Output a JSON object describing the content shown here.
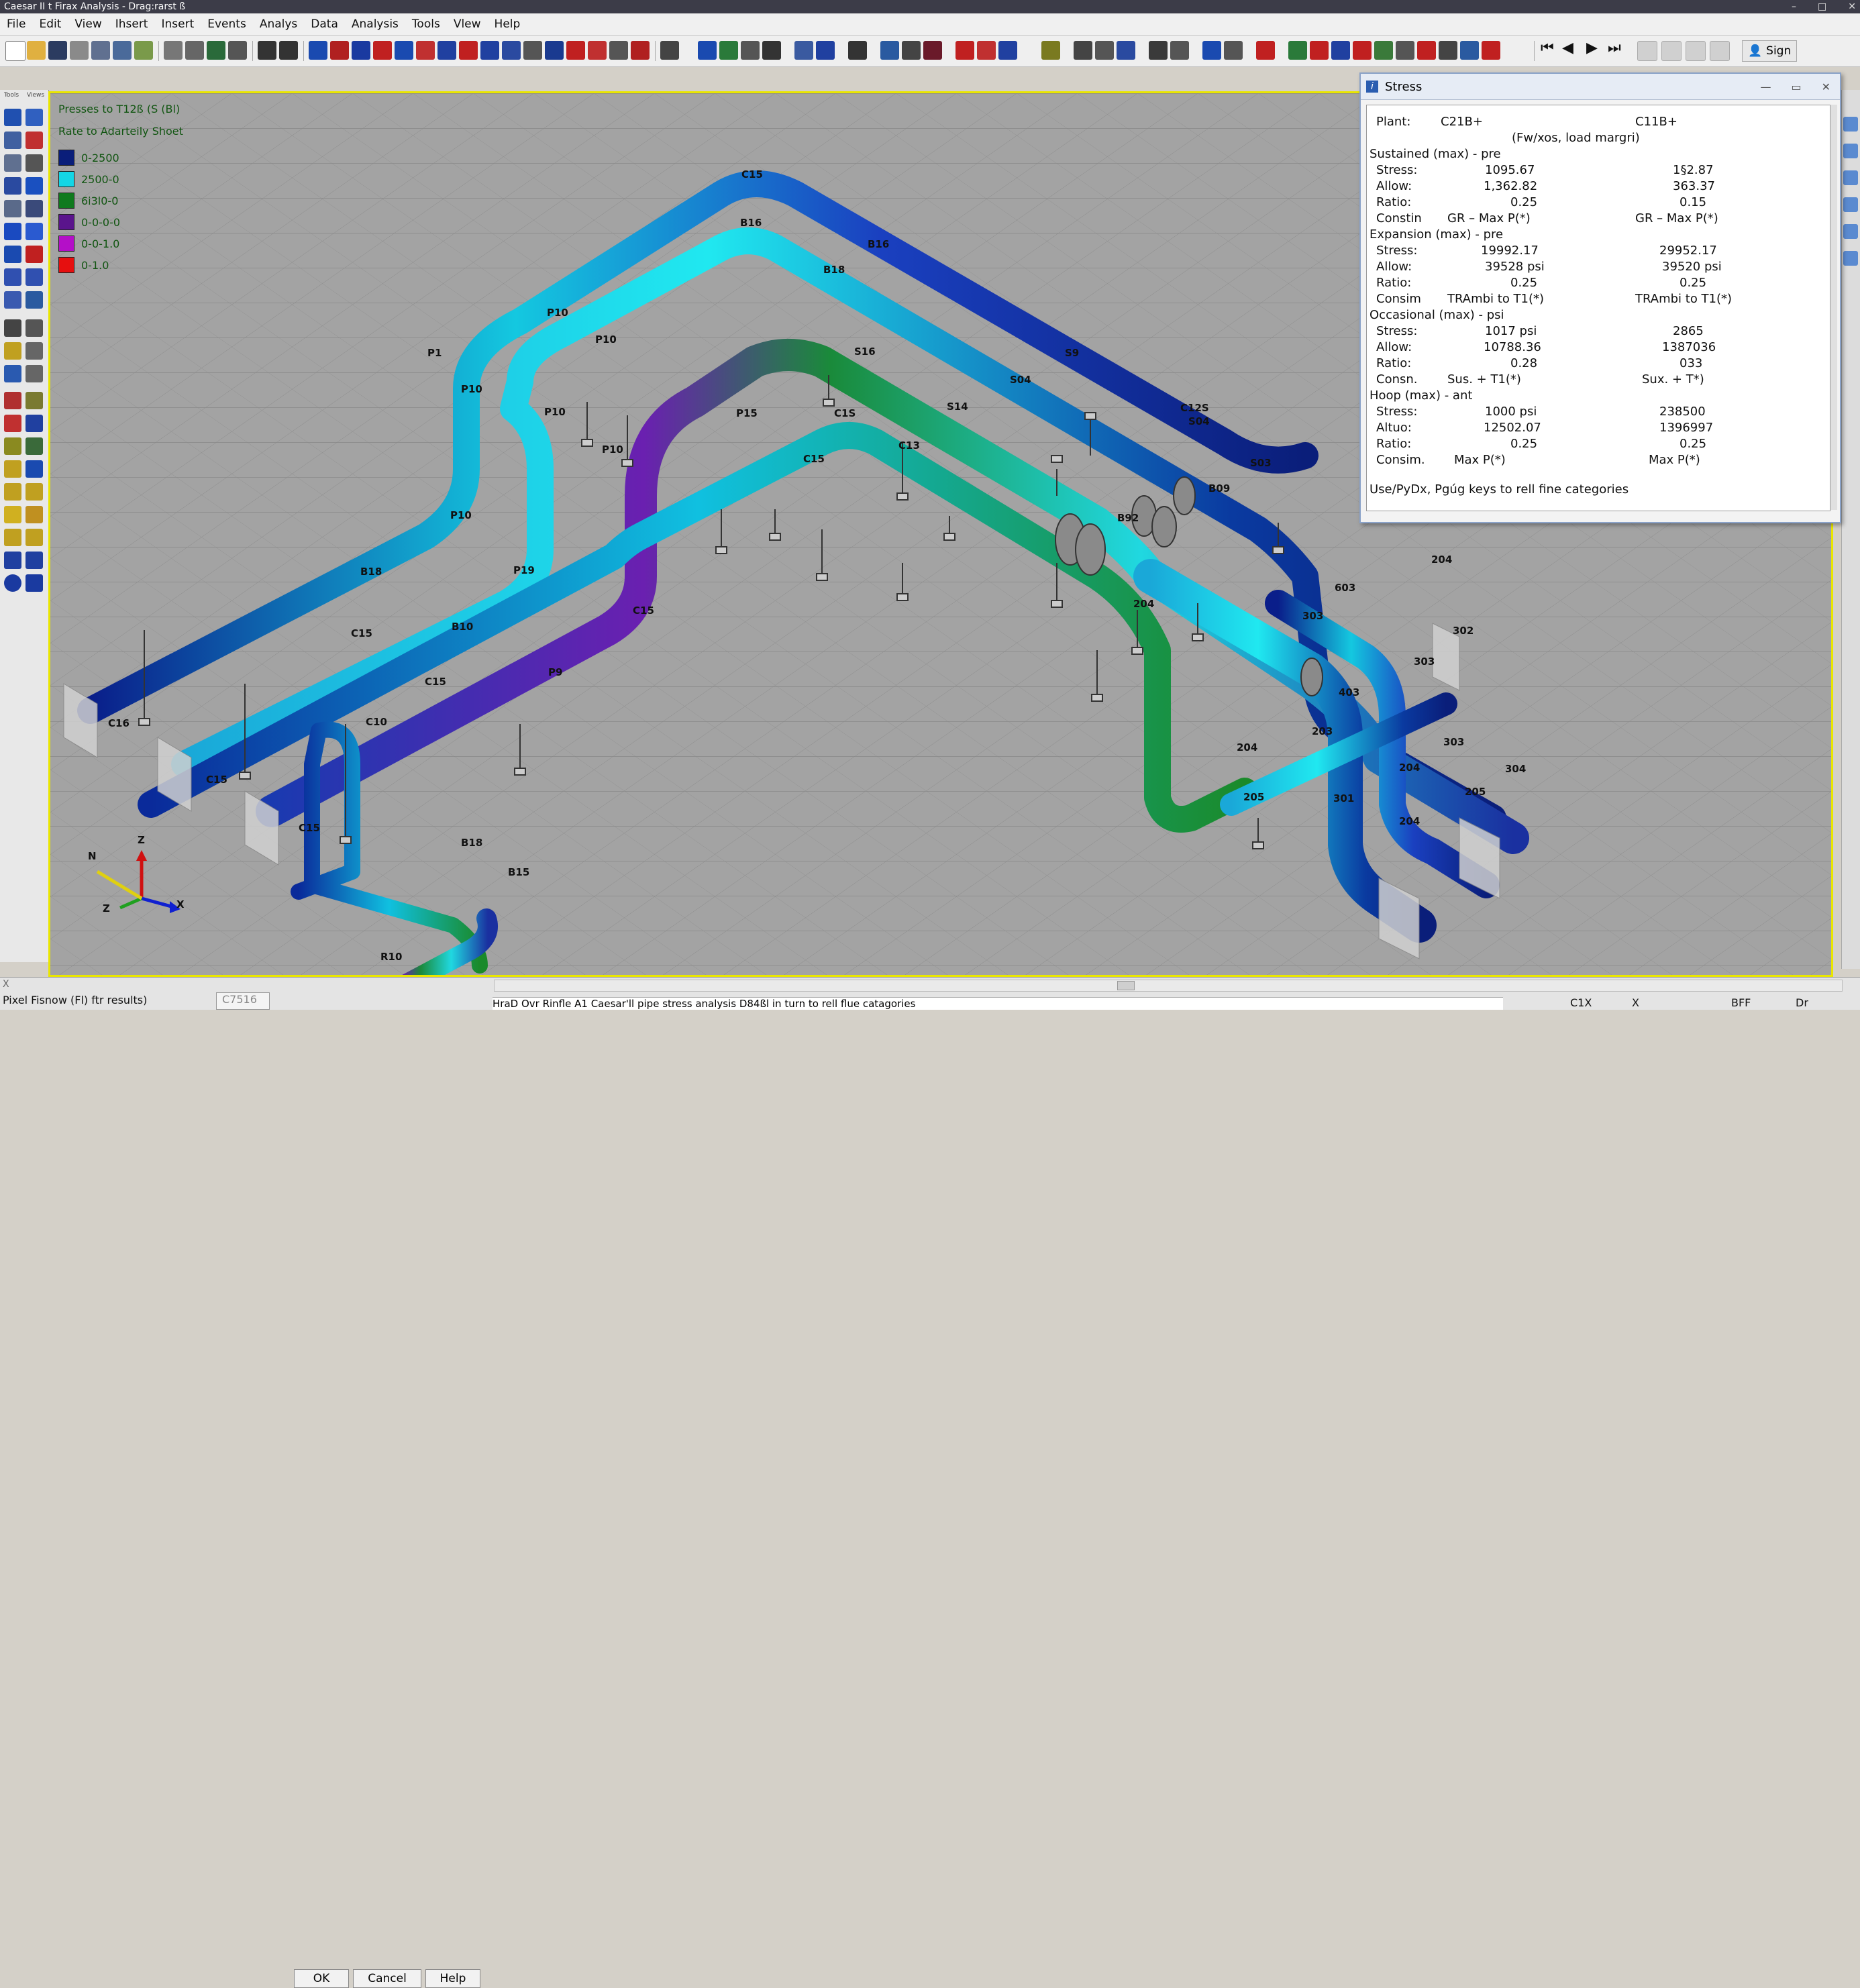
{
  "window": {
    "title": "Caesar II t Firax Analysis - Drag:rarst ß",
    "minimize": "–",
    "maximize": "□",
    "close": "✕"
  },
  "menu": [
    "File",
    "Edit",
    "View",
    "Ihsert",
    "Insert",
    "Events",
    "Analys",
    "Data",
    "Analysis",
    "Tools",
    "Vlew",
    "Help"
  ],
  "toolbar": {
    "signin_label": "Sign"
  },
  "left_header": {
    "a": "Tools",
    "b": "Views"
  },
  "legend": {
    "title": "Presses to T12ß (S (Bl)",
    "subtitle": "Rate to Adarteily Shoet",
    "ranges": [
      {
        "label": "0-2500",
        "color": "#0a1e7a"
      },
      {
        "label": "2500-0",
        "color": "#13d6e6"
      },
      {
        "label": "6i3l0-0",
        "color": "#0f7a1e"
      },
      {
        "label": "0-0-0-0",
        "color": "#5a148c"
      },
      {
        "label": "0-0-1.0",
        "color": "#b40fc8"
      },
      {
        "label": "0-1.0",
        "color": "#e60f0f"
      }
    ]
  },
  "labels": {
    "c15_top": "C15",
    "b16_top": "B16",
    "b16_b": "B16",
    "b18_a": "B18",
    "p10_a": "P10",
    "p10_b": "P10",
    "p1": "P1",
    "p10_c": "P10",
    "p10_d": "P10",
    "s16": "S16",
    "s9": "S9",
    "s14": "S14",
    "s04": "S04",
    "c12s": "C12S",
    "s04b": "S04",
    "p15": "P15",
    "c1s": "C1S",
    "p10_e": "P10",
    "c15b": "C15",
    "c13": "C13",
    "s03": "S03",
    "b09": "B09",
    "b92": "B92",
    "p10_f": "P10",
    "b18_b": "B18",
    "p19": "P19",
    "c15_c": "C15",
    "c15_d": "C15",
    "p9": "P9",
    "b10": "B10",
    "c15_e": "C15",
    "c10": "C10",
    "c16": "C16",
    "c15_f": "C15",
    "c15_g": "C15",
    "b18_c": "B18",
    "b15": "B15",
    "r10": "R10",
    "n204_a": "204",
    "n603": "603",
    "n204_b": "204",
    "n303_a": "303",
    "n302": "302",
    "n303_b": "303",
    "n403": "403",
    "n203": "203",
    "n303_c": "303",
    "n204_c": "204",
    "n205": "205",
    "n204_d": "204",
    "n205b": "205",
    "n304": "304",
    "n301": "301",
    "n204_e": "204"
  },
  "axes": {
    "n": "N",
    "z": "Z",
    "x": "X",
    "zb": "Z"
  },
  "stress_panel": {
    "title": "Stress",
    "plant_label": "Plant:",
    "plant_a": "C21B+",
    "plant_b": "C11B+",
    "subheader": "(Fw/xos, load margri)",
    "sections": [
      {
        "header": "Sustained (max) -   pre",
        "rows": [
          {
            "k": "Stress:",
            "v1": "1095.67",
            "v2": "1§2.87"
          },
          {
            "k": "Allow:",
            "v1": "1,362.82",
            "v2": "363.37"
          },
          {
            "k": "Ratio:",
            "v1": "0.25",
            "v2": "0.15"
          },
          {
            "k": "Constin",
            "v1": "GR – Max P(*)",
            "v2": "GR – Max P(*)"
          }
        ]
      },
      {
        "header": "Expansion (max) -   pre",
        "rows": [
          {
            "k": "Stress:",
            "v1": "19992.17",
            "v2": "29952.17"
          },
          {
            "k": "Allow:",
            "v1": "39528 psi",
            "v2": "39520 psi"
          },
          {
            "k": "Ratio:",
            "v1": "0.25",
            "v2": "0.25"
          },
          {
            "k": "Consim",
            "v1": "TRAmbi to T1(*)",
            "v2": "TRAmbi to T1(*)"
          }
        ]
      },
      {
        "header": "Occasional (max) -   psi",
        "rows": [
          {
            "k": "Stress:",
            "v1": "1017 psi",
            "v2": "2865"
          },
          {
            "k": "Allow:",
            "v1": "10788.36",
            "v2": "1387036"
          },
          {
            "k": "Ratio:",
            "v1": "0.28",
            "v2": "033"
          },
          {
            "k": "Consn.",
            "v1": "Sus. + T1(*)",
            "v2": "Sux. + T*)"
          }
        ]
      },
      {
        "header": "Hoop (max) - ant",
        "rows": [
          {
            "k": "Stress:",
            "v1": "1000 psi",
            "v2": "238500"
          },
          {
            "k": "Altuo:",
            "v1": "12502.07",
            "v2": "1396997"
          },
          {
            "k": "Ratio:",
            "v1": "0.25",
            "v2": "0.25"
          },
          {
            "k": "Consim.",
            "v1": "Max P(*)",
            "v2": "Max P(*)"
          }
        ]
      }
    ],
    "footer": "Use/PyDx, Pgúg keys to rell fine categories"
  },
  "status": {
    "hint": "Pixel Fisnow (Fl) ftr results)",
    "field": "C7516",
    "ok": "OK",
    "cancel": "Cancel",
    "help": "Help",
    "command": "HraD Ovr Rinfle A1 Caesar'll pipe stress analysis D84ßl in turn to rell flue catagories",
    "c1": "C1X",
    "c2": "X",
    "c3": "BFF",
    "c4": "Dr"
  }
}
